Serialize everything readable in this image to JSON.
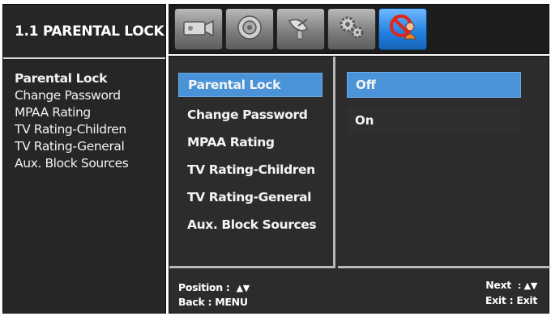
{
  "sidebar": {
    "title": "1.1 PARENTAL LOCK",
    "items": [
      {
        "label": "Parental Lock"
      },
      {
        "label": "Change Password"
      },
      {
        "label": "MPAA Rating"
      },
      {
        "label": "TV Rating-Children"
      },
      {
        "label": "TV Rating-General"
      },
      {
        "label": "Aux. Block Sources"
      }
    ]
  },
  "tabs": [
    {
      "icon": "video-input-icon"
    },
    {
      "icon": "audio-speaker-icon"
    },
    {
      "icon": "satellite-dish-icon"
    },
    {
      "icon": "settings-gears-icon"
    },
    {
      "icon": "parental-lock-icon",
      "active": true
    }
  ],
  "menu": {
    "items": [
      {
        "label": "Parental Lock",
        "selected": true
      },
      {
        "label": "Change Password"
      },
      {
        "label": "MPAA Rating"
      },
      {
        "label": "TV Rating-Children"
      },
      {
        "label": "TV Rating-General"
      },
      {
        "label": "Aux. Block Sources"
      }
    ]
  },
  "values": {
    "items": [
      {
        "label": "Off",
        "selected": true
      },
      {
        "label": "On"
      }
    ]
  },
  "footer": {
    "position_label": "Position :",
    "position_keys": "▲▼",
    "back_label": "Back : MENU",
    "next_label": "Next",
    "next_keys": ": ▲▼",
    "exit_label": "Exit",
    "exit_keys": ": Exit"
  },
  "colors": {
    "highlight": "#4a93d8",
    "panel": "#2c2c2c",
    "active_tab": "#1f7fdf"
  }
}
